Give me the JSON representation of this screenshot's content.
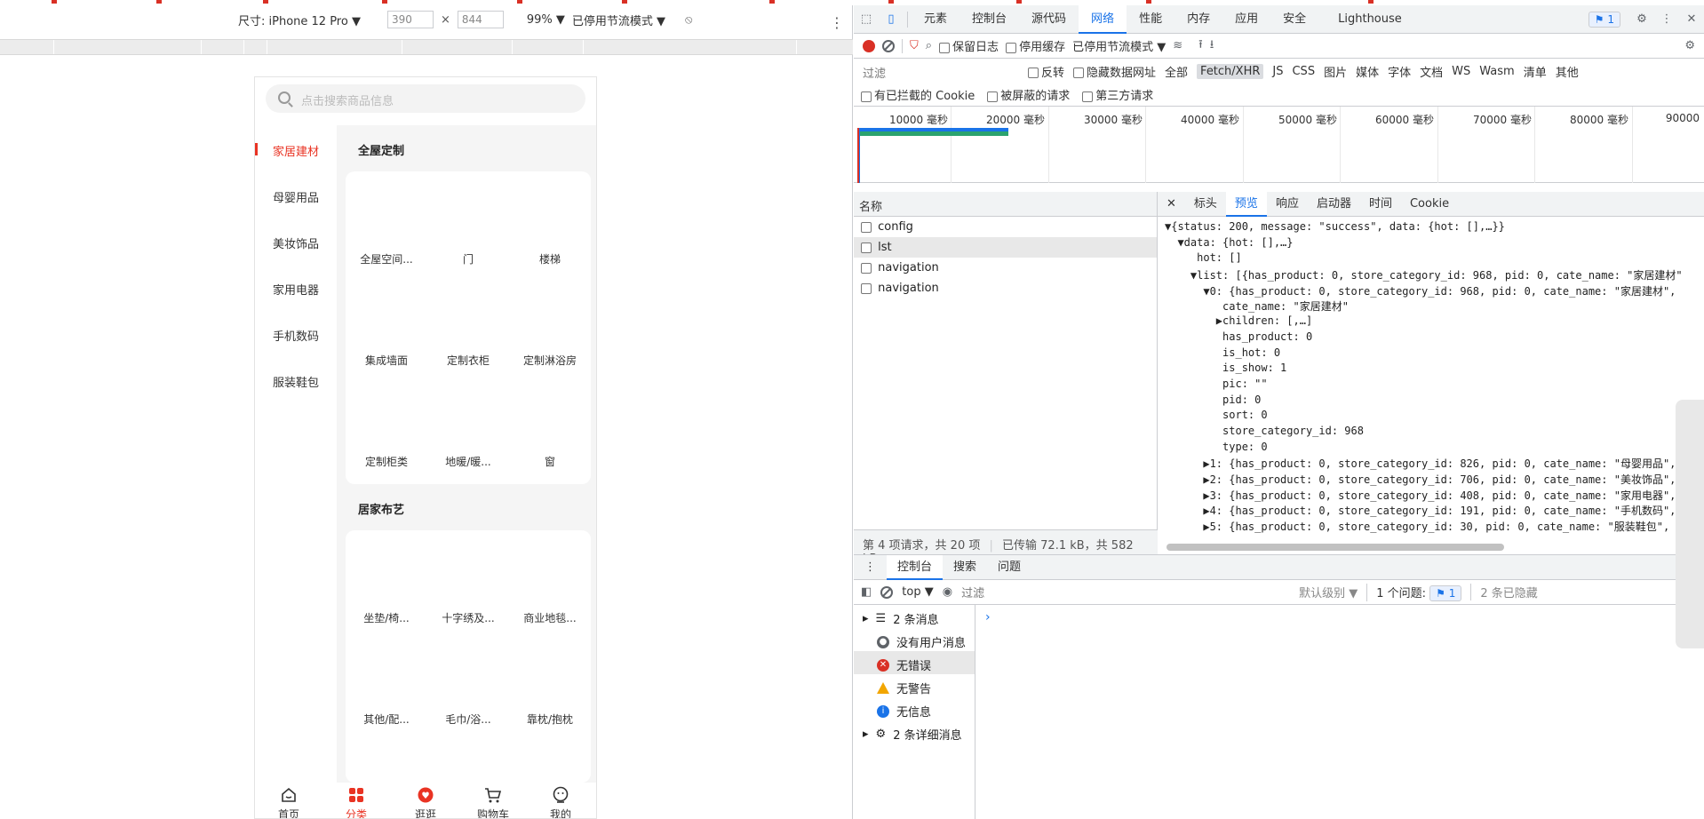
{
  "device_toolbar": {
    "size_label": "尺寸: iPhone 12 Pro ▼",
    "width": "390",
    "x": "×",
    "height": "844",
    "zoom": "99% ▼",
    "throttle": "已停用节流模式 ▼"
  },
  "phone": {
    "search_placeholder": "点击搜索商品信息",
    "categories": [
      "家居建材",
      "母婴用品",
      "美妆饰品",
      "家用电器",
      "手机数码",
      "服装鞋包"
    ],
    "section1": {
      "title": "全屋定制",
      "items": [
        "全屋空间...",
        "门",
        "楼梯",
        "集成墙面",
        "定制衣柜",
        "定制淋浴房",
        "定制柜类",
        "地暖/暖...",
        "窗"
      ]
    },
    "section2": {
      "title": "居家布艺",
      "items": [
        "坐垫/椅...",
        "十字绣及...",
        "商业地毯...",
        "其他/配...",
        "毛巾/浴...",
        "靠枕/抱枕"
      ]
    },
    "tabbar": [
      "首页",
      "分类",
      "逛逛",
      "购物车",
      "我的"
    ]
  },
  "devtools": {
    "tabs": [
      "元素",
      "控制台",
      "源代码",
      "网络",
      "性能",
      "内存",
      "应用",
      "安全",
      "Lighthouse"
    ],
    "selected_tab": "网络",
    "issues_badge": "1",
    "net_toolbar": {
      "preserve_log": "保留日志",
      "disable_cache": "停用缓存",
      "throttle": "已停用节流模式"
    },
    "filter": {
      "placeholder": "过滤",
      "invert": "反转",
      "hide_data_urls": "隐藏数据网址",
      "types": [
        "全部",
        "Fetch/XHR",
        "JS",
        "CSS",
        "图片",
        "媒体",
        "字体",
        "文档",
        "WS",
        "Wasm",
        "清单",
        "其他"
      ],
      "blocked_cookies": "有已拦截的 Cookie",
      "blocked_requests": "被屏蔽的请求",
      "third_party": "第三方请求"
    },
    "timeline_ticks": [
      "10000 毫秒",
      "20000 毫秒",
      "30000 毫秒",
      "40000 毫秒",
      "50000 毫秒",
      "60000 毫秒",
      "70000 毫秒",
      "80000 毫秒",
      "90000"
    ],
    "requests": {
      "header": "名称",
      "rows": [
        "config",
        "lst",
        "navigation",
        "navigation"
      ],
      "status": "第 4 项请求，共 20 项",
      "transferred": "已传输 72.1 kB，共 582 kB"
    },
    "detail_tabs": [
      "标头",
      "预览",
      "响应",
      "启动器",
      "时间",
      "Cookie"
    ],
    "json_lines": [
      "▼{status: 200, message: \"success\", data: {hot: [],…}}",
      "  ▼data: {hot: [],…}",
      "     hot: []",
      "    ▼list: [{has_product: 0, store_category_id: 968, pid: 0, cate_name: \"家居建材\"",
      "      ▼0: {has_product: 0, store_category_id: 968, pid: 0, cate_name: \"家居建材\",",
      "         cate_name: \"家居建材\"",
      "        ▶children: [,…]",
      "         has_product: 0",
      "         is_hot: 0",
      "         is_show: 1",
      "         pic: \"\"",
      "         pid: 0",
      "         sort: 0",
      "         store_category_id: 968",
      "         type: 0",
      "      ▶1: {has_product: 0, store_category_id: 826, pid: 0, cate_name: \"母婴用品\",",
      "      ▶2: {has_product: 0, store_category_id: 706, pid: 0, cate_name: \"美妆饰品\",",
      "      ▶3: {has_product: 0, store_category_id: 408, pid: 0, cate_name: \"家用电器\",",
      "      ▶4: {has_product: 0, store_category_id: 191, pid: 0, cate_name: \"手机数码\",",
      "      ▶5: {has_product: 0, store_category_id: 30, pid: 0, cate_name: \"服装鞋包\","
    ],
    "console": {
      "tabs": [
        "控制台",
        "搜索",
        "问题"
      ],
      "context": "top ▼",
      "filter_placeholder": "过滤",
      "level": "默认级别 ▼",
      "issues": "1 个问题:",
      "issues_count": "1",
      "hidden": "2 条已隐藏",
      "sidebar": [
        "2 条消息",
        "没有用户消息",
        "无错误",
        "无警告",
        "无信息",
        "2 条详细消息"
      ]
    }
  },
  "colors": {
    "accent_red": "#e93323",
    "devtools_blue": "#1a73e8"
  }
}
